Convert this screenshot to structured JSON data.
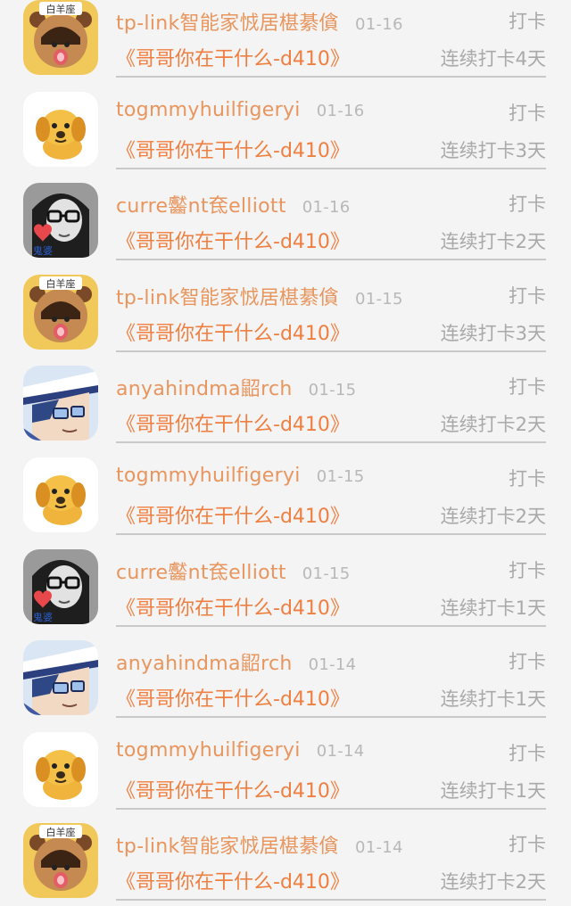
{
  "rows": [
    {
      "avatar": "bear-costume-avatar",
      "name": "tp-link智能家㤜居椹綦僋",
      "date": "01-16",
      "action": "打卡",
      "topic": "《哥哥你在干什么-d410》",
      "streak": "连续打卡4天"
    },
    {
      "avatar": "puppy-avatar",
      "name": "togmmyhuilfigeryi",
      "date": "01-16",
      "action": "打卡",
      "topic": "《哥哥你在干什么-d410》",
      "streak": "连续打卡3天"
    },
    {
      "avatar": "glasses-girl-avatar",
      "name": "curre齾nt奃elliott",
      "date": "01-16",
      "action": "打卡",
      "topic": "《哥哥你在干什么-d410》",
      "streak": "连续打卡2天"
    },
    {
      "avatar": "bear-costume-avatar",
      "name": "tp-link智能家㤜居椹綦僋",
      "date": "01-15",
      "action": "打卡",
      "topic": "《哥哥你在干什么-d410》",
      "streak": "连续打卡3天"
    },
    {
      "avatar": "anime-boy-avatar",
      "name": "anyahindma鼦rch",
      "date": "01-15",
      "action": "打卡",
      "topic": "《哥哥你在干什么-d410》",
      "streak": "连续打卡2天"
    },
    {
      "avatar": "puppy-avatar",
      "name": "togmmyhuilfigeryi",
      "date": "01-15",
      "action": "打卡",
      "topic": "《哥哥你在干什么-d410》",
      "streak": "连续打卡2天"
    },
    {
      "avatar": "glasses-girl-avatar",
      "name": "curre齾nt奃elliott",
      "date": "01-15",
      "action": "打卡",
      "topic": "《哥哥你在干什么-d410》",
      "streak": "连续打卡1天"
    },
    {
      "avatar": "anime-boy-avatar",
      "name": "anyahindma鼦rch",
      "date": "01-14",
      "action": "打卡",
      "topic": "《哥哥你在干什么-d410》",
      "streak": "连续打卡1天"
    },
    {
      "avatar": "puppy-avatar",
      "name": "togmmyhuilfigeryi",
      "date": "01-14",
      "action": "打卡",
      "topic": "《哥哥你在干什么-d410》",
      "streak": "连续打卡1天"
    },
    {
      "avatar": "bear-costume-avatar",
      "name": "tp-link智能家㤜居椹綦僋",
      "date": "01-14",
      "action": "打卡",
      "topic": "《哥哥你在干什么-d410》",
      "streak": "连续打卡2天"
    }
  ],
  "avatar_badge_text": "白羊座",
  "avatar_sticker_text": "鬼婆",
  "colors": {
    "name": "#e8955e",
    "topic": "#ef7f40",
    "meta": "#a9a9a9",
    "date": "#b8b8b8",
    "divider": "#c9c9c9",
    "background": "#f4f4f4"
  }
}
